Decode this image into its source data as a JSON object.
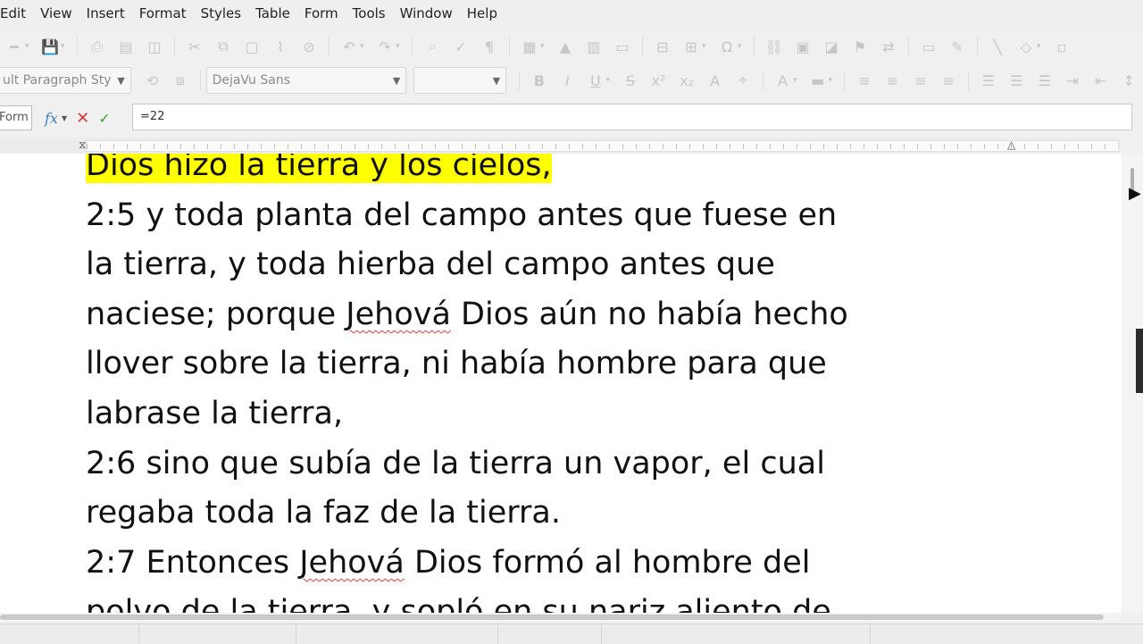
{
  "menu": [
    "Edit",
    "View",
    "Insert",
    "Format",
    "Styles",
    "Table",
    "Form",
    "Tools",
    "Window",
    "Help"
  ],
  "format_toolbar": {
    "paragraph_style": "ult Paragraph Sty",
    "font_name": "DejaVu Sans",
    "font_size": ""
  },
  "formula_bar": {
    "name_box": "Form",
    "formula": "=22"
  },
  "document": {
    "lines": [
      {
        "text": "Dios hizo la tierra y los cielos,",
        "highlight": true
      },
      {
        "text": "2:5 y toda planta del campo antes que fuese en"
      },
      {
        "text": "la tierra, y toda hierba del campo antes que"
      },
      {
        "pre": "naciese; porque ",
        "spell": "Jehová",
        "post": " Dios aún no había hecho"
      },
      {
        "text": "llover sobre la tierra, ni había hombre para que"
      },
      {
        "text": "labrase la tierra,"
      },
      {
        "text": "2:6 sino que subía de la tierra un vapor, el cual"
      },
      {
        "text": "regaba toda la faz de la tierra."
      },
      {
        "pre": "2:7 Entonces ",
        "spell": "Jehová",
        "post": " Dios formó al hombre del"
      },
      {
        "text": "polvo de la tierra, y sopló en su nariz aliento de"
      }
    ]
  },
  "colors": {
    "highlight": "#ffff00",
    "spellcheck": "#e53935",
    "cancel": "#d73a3a",
    "accept": "#3aa23a"
  }
}
